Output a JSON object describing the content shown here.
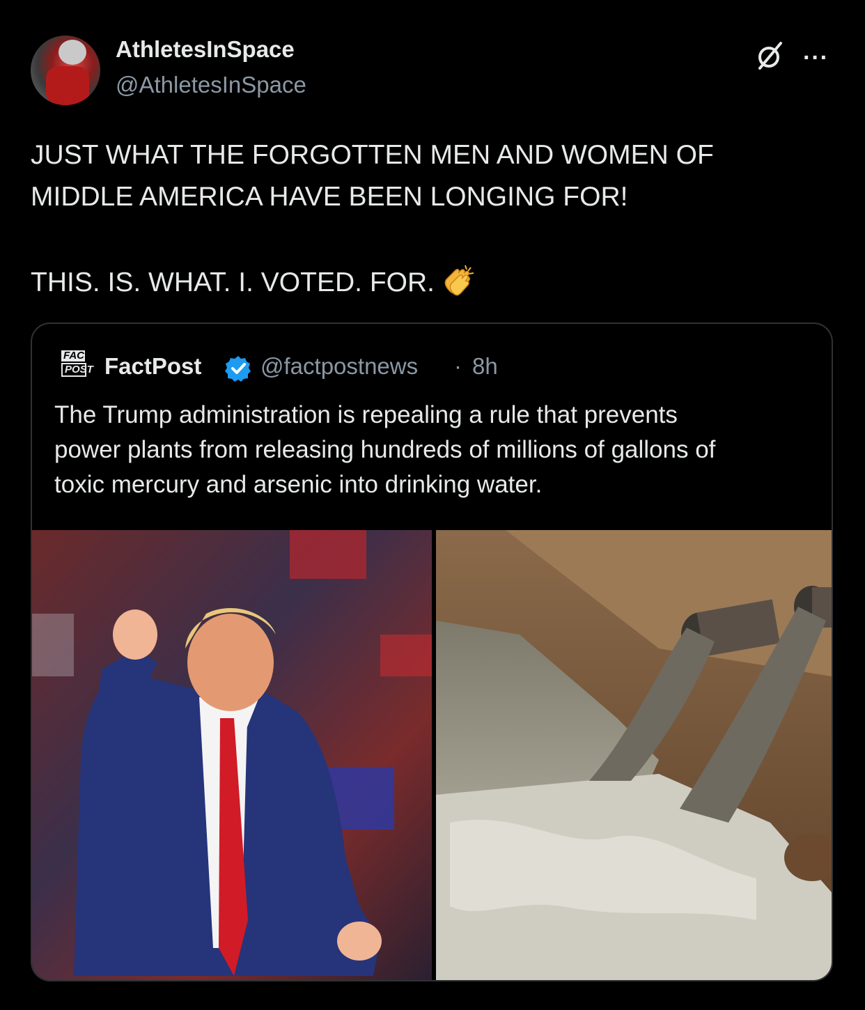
{
  "author": {
    "display_name": "AthletesInSpace",
    "handle": "@AthletesInSpace",
    "avatar_icon": "football-player-avatar"
  },
  "header_actions": {
    "grok_icon": "slashed-circle-icon",
    "more_icon": "more-icon",
    "more_label": "···"
  },
  "post": {
    "lines": [
      "JUST WHAT THE FORGOTTEN MEN AND WOMEN OF",
      "MIDDLE AMERICA HAVE BEEN LONGING FOR!",
      "THIS. IS. WHAT. I. VOTED. FOR."
    ],
    "emoji": "clapping-hands"
  },
  "quoted": {
    "logo_line1": "FACT",
    "logo_line2": "POST",
    "display_name": "FactPost",
    "verified": true,
    "handle": "@factpostnews",
    "separator": "·",
    "time": "8h",
    "lines": [
      "The Trump administration is repealing a rule that prevents",
      "power plants from releasing hundreds of millions of gallons of",
      "toxic mercury and arsenic into drinking water."
    ],
    "media": [
      "politician-rally-photo",
      "pipes-discharging-wastewater-photo"
    ]
  },
  "colors": {
    "background": "#000000",
    "text": "#e7e9ea",
    "secondary": "#8b98a5",
    "border": "#2f3336",
    "verified": "#1d9bf0"
  }
}
